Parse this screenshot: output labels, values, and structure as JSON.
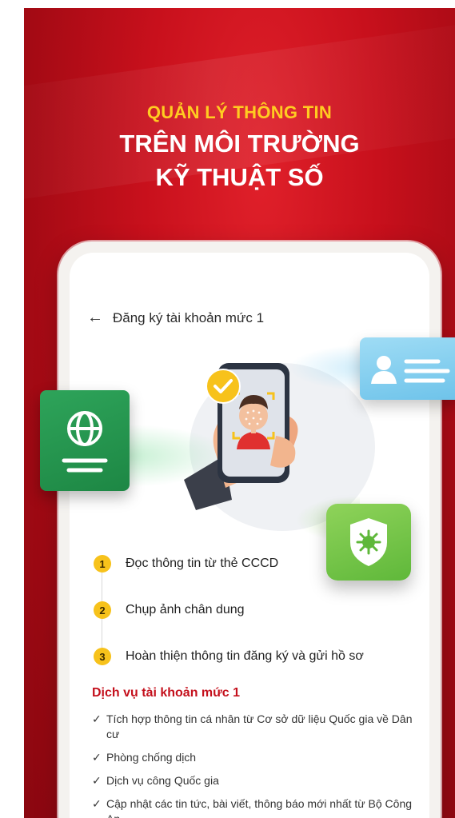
{
  "headline": {
    "line1": "QUẢN LÝ THÔNG TIN",
    "line2": "TRÊN MÔI TRƯỜNG",
    "line3": "KỸ THUẬT SỐ"
  },
  "nav": {
    "back_glyph": "←",
    "title": "Đăng ký tài khoản mức 1"
  },
  "steps": [
    {
      "num": "1",
      "label": "Đọc thông tin từ thẻ CCCD"
    },
    {
      "num": "2",
      "label": "Chụp ảnh chân dung"
    },
    {
      "num": "3",
      "label": "Hoàn thiện thông tin đăng ký và gửi hồ sơ"
    }
  ],
  "services": {
    "title": "Dịch vụ tài khoản mức 1",
    "items": [
      "Tích hợp thông tin cá nhân từ Cơ sở dữ liệu Quốc gia về Dân cư",
      "Phòng chống dịch",
      "Dịch vụ công Quốc gia",
      "Cập nhật các tin tức, bài viết, thông báo mới nhất từ Bộ Công An"
    ],
    "check_glyph": "✓"
  },
  "icons": {
    "globe_card": "globe-card-icon",
    "user_card": "user-id-card-icon",
    "shield_card": "shield-virus-icon",
    "face_scan": "face-scan-icon",
    "checkmark_badge": "check-badge-icon"
  },
  "colors": {
    "background_red": "#c8101c",
    "headline_yellow": "#ffcc21",
    "accent_red": "#c4101c",
    "step_badge": "#f7c21b",
    "green_card": "#2ea45a",
    "blue_card": "#6ec3ea",
    "lime_card": "#5fb83a"
  }
}
